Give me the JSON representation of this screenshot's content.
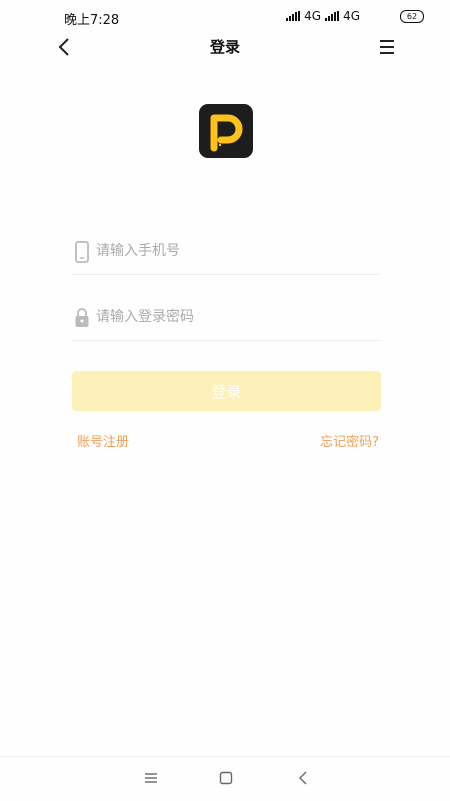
{
  "status_bar": {
    "time": "晚上7:28",
    "network1": "4G",
    "network2": "4G",
    "battery": "62"
  },
  "nav": {
    "title": "登录"
  },
  "form": {
    "phone_placeholder": "请输入手机号",
    "password_placeholder": "请输入登录密码",
    "login_label": "登录",
    "register_link": "账号注册",
    "forgot_link": "忘记密码?"
  },
  "colors": {
    "brand": "#ffc21a",
    "login_button": "#fdf0b8",
    "link": "#f0a05a"
  },
  "icons": [
    "back-icon",
    "menu-icon",
    "phone-icon",
    "lock-icon",
    "app-logo",
    "sys-menu-icon",
    "sys-home-icon",
    "sys-back-icon"
  ]
}
